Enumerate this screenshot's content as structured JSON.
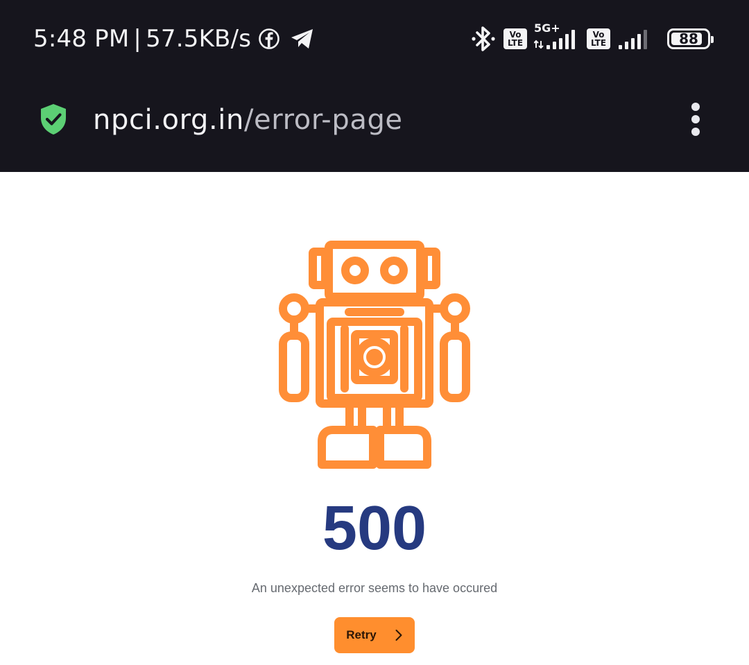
{
  "status_bar": {
    "time": "5:48 PM",
    "separator": "|",
    "network_speed": "57.5KB/s",
    "notification_icons": [
      "facebook-icon",
      "telegram-icon"
    ],
    "bluetooth_icon": "bluetooth-icon",
    "sim1": {
      "volte_top": "Vo",
      "volte_bottom": "LTE",
      "network_type": "5G+"
    },
    "sim2": {
      "volte_top": "Vo",
      "volte_bottom": "LTE"
    },
    "battery_level": "88"
  },
  "address_bar": {
    "secure_icon": "shield-check-icon",
    "url_host": "npci.org.in",
    "url_path": "/error-page",
    "menu_icon": "more-vertical-icon"
  },
  "error_page": {
    "illustration": "robot-icon",
    "code": "500",
    "message": "An unexpected error seems to have occured",
    "retry_label": "Retry",
    "retry_icon": "chevron-right-icon"
  },
  "colors": {
    "topbar_bg": "#16151d",
    "accent_orange": "#ff8e2e",
    "error_code_blue": "#263a80",
    "secure_green": "#5ccf74",
    "message_gray": "#666a70"
  }
}
